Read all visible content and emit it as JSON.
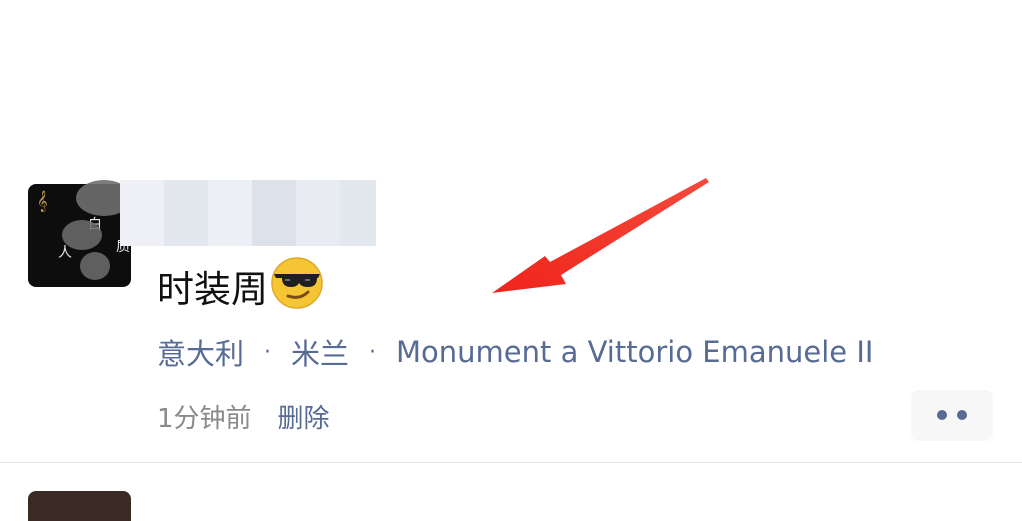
{
  "post": {
    "content_text": "时装周",
    "emoji": "😏",
    "emoji_name": "smirking-sunglasses-emoji",
    "location": {
      "country": "意大利",
      "city": "米兰",
      "place": "Monument a Vittorio Emanuele II",
      "separator": "·"
    },
    "time": "1分钟前",
    "delete_label": "删除",
    "more_icon": "more-dots-icon"
  },
  "colors": {
    "link": "#576b95",
    "text": "#111111",
    "muted": "#8a8a8a",
    "annotation_arrow": "#f23a2f"
  }
}
